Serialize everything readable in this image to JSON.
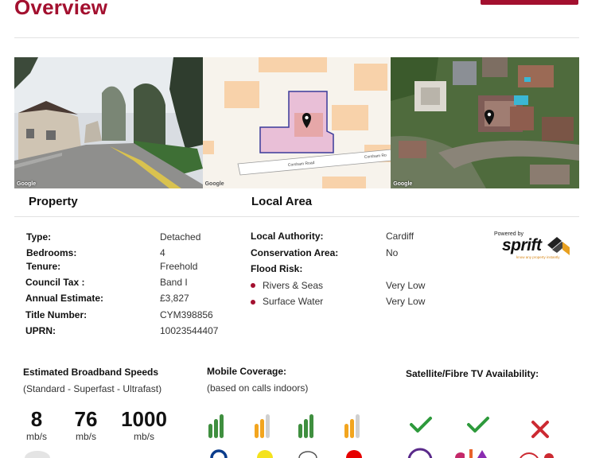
{
  "page": {
    "title": "Overview",
    "accent": "#a3102f"
  },
  "photos": [
    {
      "icon": "street-view-photo",
      "credit": "Google"
    },
    {
      "icon": "map-plan",
      "credit": "Google",
      "street_left": "Corsham Road",
      "street_right": "Corsham Ro"
    },
    {
      "icon": "satellite-photo",
      "credit": "Google"
    }
  ],
  "property": {
    "heading": "Property",
    "rows": [
      {
        "label": "Type:",
        "value": "Detached"
      },
      {
        "label": "Bedrooms:",
        "value": "4"
      },
      {
        "label": "Tenure:",
        "value": "Freehold"
      },
      {
        "label": "Council Tax :",
        "value": "Band I"
      },
      {
        "label": "Annual Estimate:",
        "value": "£3,827"
      },
      {
        "label": "Title Number:",
        "value": "CYM398856"
      },
      {
        "label": "UPRN:",
        "value": "10023544407"
      }
    ]
  },
  "local_area": {
    "heading": "Local Area",
    "rows": [
      {
        "label": "Local Authority:",
        "value": "Cardiff"
      },
      {
        "label": "Conservation Area:",
        "value": "No"
      },
      {
        "label": "Flood Risk:",
        "value": ""
      }
    ],
    "flood": [
      {
        "label": "Rivers & Seas",
        "value": "Very Low"
      },
      {
        "label": "Surface Water",
        "value": "Very Low"
      }
    ]
  },
  "brand": {
    "powered_by": "Powered by",
    "name": "sprift",
    "tagline": "know any property instantly",
    "colors": {
      "dark": "#222222",
      "orange": "#e8a020"
    }
  },
  "broadband": {
    "heading": "Estimated Broadband Speeds",
    "note": "(Standard - Superfast - Ultrafast)",
    "speeds": [
      {
        "value": "8",
        "unit": "mb/s"
      },
      {
        "value": "76",
        "unit": "mb/s"
      },
      {
        "value": "1000",
        "unit": "mb/s"
      }
    ]
  },
  "mobile": {
    "heading": "Mobile Coverage:",
    "note": "(based on calls indoors)",
    "networks": [
      {
        "filled": 3,
        "total": 3,
        "color": "#3f8f3f"
      },
      {
        "filled": 2,
        "total": 3,
        "color": "#f2a51f"
      },
      {
        "filled": 3,
        "total": 3,
        "color": "#3f8f3f"
      },
      {
        "filled": 2,
        "total": 3,
        "color": "#f2a51f"
      }
    ],
    "empty_color": "#d0d0d0"
  },
  "tv": {
    "heading": "Satellite/Fibre TV Availability:",
    "items": [
      {
        "available": true,
        "icon": "check-icon"
      },
      {
        "available": true,
        "icon": "check-icon"
      },
      {
        "available": false,
        "icon": "cross-icon"
      }
    ],
    "check_color": "#2e9a3c",
    "cross_color": "#cc2a32"
  }
}
